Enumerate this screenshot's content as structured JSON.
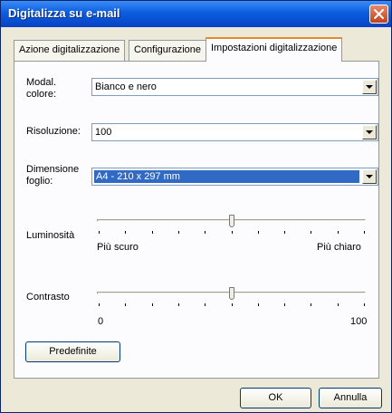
{
  "window": {
    "title": "Digitalizza su e-mail"
  },
  "tabs": [
    {
      "label": "Azione digitalizzazione"
    },
    {
      "label": "Configurazione"
    },
    {
      "label": "Impostazioni digitalizzazione"
    }
  ],
  "settings": {
    "color_mode": {
      "label": "Modal.\ncolore:",
      "value": "Bianco e nero"
    },
    "resolution": {
      "label": "Risoluzione:",
      "value": "100"
    },
    "paper_size": {
      "label": "Dimensione\nfoglio:",
      "value": "A4 - 210 x 297 mm"
    },
    "brightness": {
      "label": "Luminosità",
      "min_label": "Più scuro",
      "max_label": "Più chiaro",
      "level_fraction": 0.5
    },
    "contrast": {
      "label": "Contrasto",
      "min_label": "0",
      "max_label": "100",
      "level_fraction": 0.5
    }
  },
  "buttons": {
    "defaults": "Predefinite",
    "ok": "OK",
    "cancel": "Annulla"
  }
}
